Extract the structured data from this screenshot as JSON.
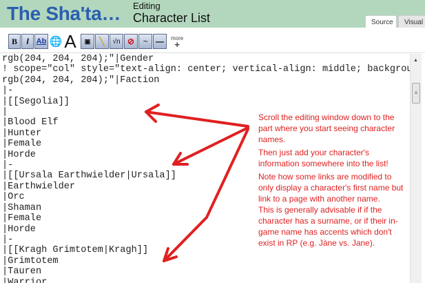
{
  "header": {
    "site_title": "The Sha'ta…",
    "editing_label": "Editing",
    "page_title": "Character List"
  },
  "tabs": [
    {
      "label": "Source"
    },
    {
      "label": "Visual"
    }
  ],
  "toolbar": {
    "bold": "B",
    "italic": "I",
    "link": "Ab",
    "font": "A",
    "more_label": "more",
    "more_plus": "+"
  },
  "editor_lines": [
    "rgb(204, 204, 204);\"|Gender",
    "! scope=\"col\" style=\"text-align: center; vertical-align: middle; background-color:",
    "rgb(204, 204, 204);\"|Faction",
    "|-",
    "|[[Segolia]]",
    "|",
    "|Blood Elf",
    "|Hunter",
    "|Female",
    "|Horde",
    "|-",
    "|[[Ursala Earthwielder|Ursala]]",
    "|Earthwielder",
    "|Orc",
    "|Shaman",
    "|Female",
    "|Horde",
    "|-",
    "|[[Kragh Grimtotem|Kragh]]",
    "|Grimtotem",
    "|Tauren",
    "|Warrior"
  ],
  "annotation": {
    "p1": "Scroll the editing window down to the part where you start seeing character names.",
    "p2": "Then just add your character's information somewhere into the list!",
    "p3": "Note how some links are modified to only display a character's first name but link to a page with another name.",
    "p4": "This is generally advisable if if the character has a surname, or if their in-game name has accents which don't exist in RP (e.g. Jàne vs. Jane).",
    "color": "#e02020"
  }
}
